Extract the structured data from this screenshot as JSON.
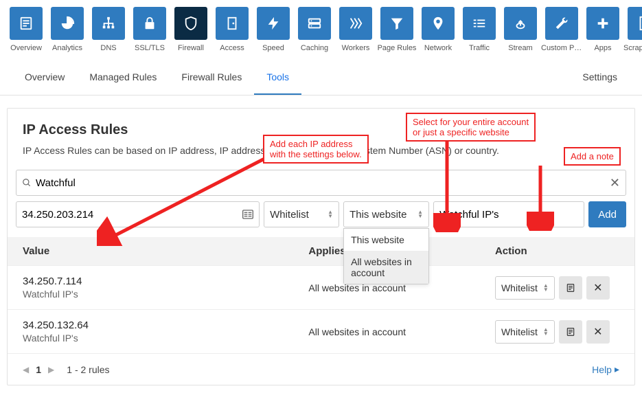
{
  "nav_tiles": [
    {
      "label": "Overview",
      "icon": "overview"
    },
    {
      "label": "Analytics",
      "icon": "analytics"
    },
    {
      "label": "DNS",
      "icon": "dns"
    },
    {
      "label": "SSL/TLS",
      "icon": "lock"
    },
    {
      "label": "Firewall",
      "icon": "shield",
      "active": true
    },
    {
      "label": "Access",
      "icon": "door"
    },
    {
      "label": "Speed",
      "icon": "bolt"
    },
    {
      "label": "Caching",
      "icon": "cache"
    },
    {
      "label": "Workers",
      "icon": "workers"
    },
    {
      "label": "Page Rules",
      "icon": "filter"
    },
    {
      "label": "Network",
      "icon": "pin"
    },
    {
      "label": "Traffic",
      "icon": "traffic"
    },
    {
      "label": "Stream",
      "icon": "stream"
    },
    {
      "label": "Custom Pa...",
      "icon": "wrench"
    },
    {
      "label": "Apps",
      "icon": "plus"
    },
    {
      "label": "Scrape Shi...",
      "icon": "doc"
    }
  ],
  "subtabs": {
    "items": [
      "Overview",
      "Managed Rules",
      "Firewall Rules",
      "Tools"
    ],
    "active": "Tools",
    "settings": "Settings"
  },
  "panel": {
    "title": "IP Access Rules",
    "description": "IP Access Rules can be based on IP address, IP address range, Autonomous System Number (ASN) or country."
  },
  "search": {
    "value": "Watchful",
    "placeholder": ""
  },
  "add_row": {
    "ip_value": "34.250.203.214",
    "action_select": "Whitelist",
    "scope_select": "This website",
    "scope_options": [
      "This website",
      "All websites in account"
    ],
    "note_value": "Watchful IP's",
    "add_label": "Add"
  },
  "table": {
    "headers": {
      "value": "Value",
      "applies": "Applies to",
      "action": "Action"
    },
    "rows": [
      {
        "ip": "34.250.7.114",
        "note": "Watchful IP's",
        "applies": "All websites in account",
        "action": "Whitelist"
      },
      {
        "ip": "34.250.132.64",
        "note": "Watchful IP's",
        "applies": "All websites in account",
        "action": "Whitelist"
      }
    ]
  },
  "footer": {
    "page": "1",
    "count_text": "1 - 2 rules",
    "help": "Help"
  },
  "annotations": {
    "ip": "Add each IP address\nwith the settings below.",
    "scope": "Select for your entire account\nor just a specific website",
    "note": "Add a note"
  }
}
